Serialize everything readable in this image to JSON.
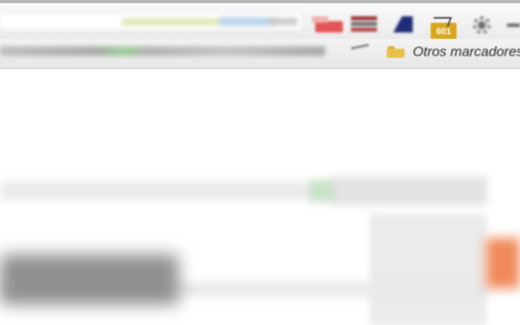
{
  "window": {
    "extensions": [
      {
        "icon": "red-extension-icon"
      },
      {
        "icon": "stacked-extension-icon"
      },
      {
        "icon": "navy-extension-icon"
      },
      {
        "icon": "chart-badge-icon",
        "badge_text": "601"
      },
      {
        "icon": "gear-icon"
      },
      {
        "icon": "arrow-icon"
      }
    ]
  },
  "bookmarks": {
    "other_label": "Otros marcadores",
    "other_icon": "folder-icon"
  },
  "colors": {
    "toolbar_bg": "#efefef",
    "badge_yellow": "#d8a61e",
    "folder_yellow": "#e7c04a",
    "accent_orange": "#f08a5a"
  }
}
